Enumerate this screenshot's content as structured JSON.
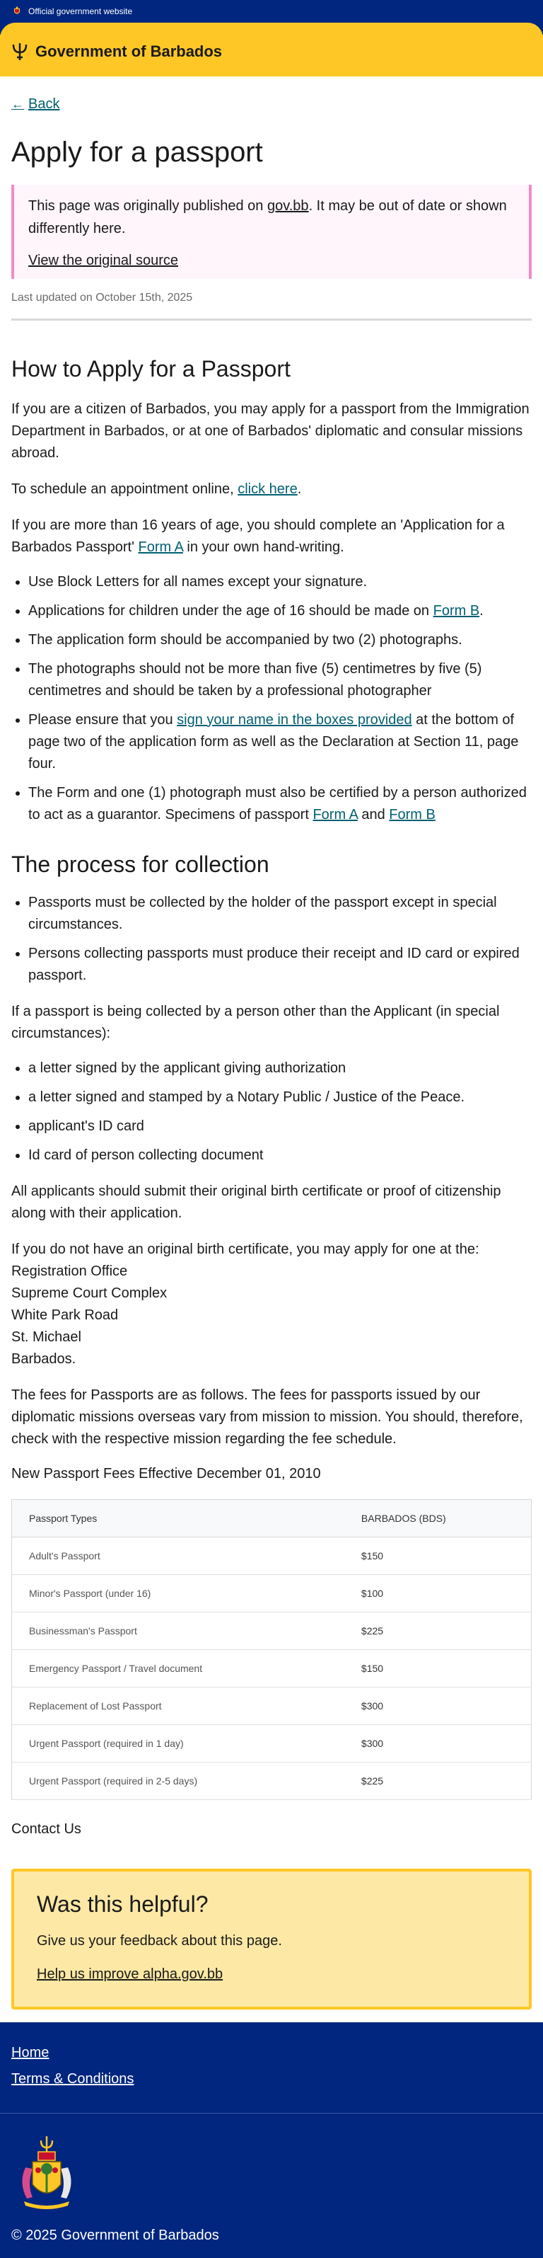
{
  "topbar": {
    "label": "Official government website"
  },
  "header": {
    "brand": "Government of Barbados"
  },
  "nav": {
    "back": "Back"
  },
  "page": {
    "title": "Apply for a passport",
    "notice_prefix": "This page was originally published on ",
    "notice_link": "gov.bb",
    "notice_suffix": ". It may be out of date or shown differently here.",
    "notice_source": "View the original source",
    "updated": "Last updated on October 15th, 2025"
  },
  "how": {
    "heading": "How to Apply for a Passport",
    "p1": "If you are a citizen of Barbados, you may apply for a passport from the Immigration Department in Barbados, or at one of Barbados' diplomatic and consular missions abroad.",
    "p2_prefix": "To schedule an appointment online, ",
    "p2_link": "click here",
    "p2_suffix": ".",
    "p3_prefix": "If you are more than 16 years of age, you should complete an 'Application for a Barbados Passport' ",
    "p3_link": "Form A",
    "p3_suffix": " in your own hand-writing.",
    "b1": "Use Block Letters for all names except your signature.",
    "b2_prefix": "Applications for children under the age of 16 should be made on ",
    "b2_link": "Form B",
    "b2_suffix": ".",
    "b3": "The application form should be accompanied by two (2) photographs.",
    "b4": "The photographs should not be more than five (5) centimetres by five (5) centimetres and should be taken by a professional photographer",
    "b5_prefix": "Please ensure that you ",
    "b5_link": "sign your name in the boxes provided",
    "b5_suffix": " at the bottom of page two of the application form as well as the Declaration at Section 11, page four.",
    "b6_prefix": "The Form and one (1) photograph must also be certified by a person authorized to act as a guarantor. Specimens of passport ",
    "b6_link1": "Form A",
    "b6_mid": " and ",
    "b6_link2": "Form B"
  },
  "collection": {
    "heading": "The process for collection",
    "b1": "Passports must be collected by the holder of the passport except in special circumstances.",
    "b2": "Persons collecting passports must produce their receipt and ID card or expired passport.",
    "p1": "If a passport is being collected by a person other than the Applicant (in special circumstances):",
    "c1": "a letter signed by the applicant giving authorization",
    "c2": "a letter signed and stamped by a Notary Public / Justice of the Peace.",
    "c3": "applicant's ID card",
    "c4": "Id card of person collecting document",
    "p2": "All applicants should submit their original birth certificate or proof of citizenship along with their application.",
    "p3": "If you do not have an original birth certificate, you may apply for one at the:",
    "addr1": "Registration Office",
    "addr2": "Supreme Court Complex",
    "addr3": "White Park Road",
    "addr4": "St. Michael",
    "addr5": "Barbados.",
    "p4": "The fees for Passports are as follows. The fees for passports issued by our diplomatic missions overseas vary from mission to mission. You should, therefore, check with the respective mission regarding the fee schedule.",
    "fees_title": "New Passport Fees Effective December 01, 2010"
  },
  "fees": {
    "col1": "Passport Types",
    "col2": "BARBADOS (BDS)",
    "rows": [
      {
        "type": "Adult's Passport",
        "price": "$150"
      },
      {
        "type": "Minor's Passport (under 16)",
        "price": "$100"
      },
      {
        "type": "Businessman's Passport",
        "price": "$225"
      },
      {
        "type": "Emergency Passport / Travel document",
        "price": "$150"
      },
      {
        "type": "Replacement of Lost Passport",
        "price": "$300"
      },
      {
        "type": "Urgent Passport (required in 1 day)",
        "price": "$300"
      },
      {
        "type": "Urgent Passport (required in 2-5 days)",
        "price": "$225"
      }
    ]
  },
  "contact": {
    "label": "Contact Us"
  },
  "feedback": {
    "heading": "Was this helpful?",
    "text": "Give us your feedback about this page.",
    "link": "Help us improve alpha.gov.bb"
  },
  "footer": {
    "home": "Home",
    "terms": "Terms & Conditions",
    "copyright": "© 2025 Government of Barbados"
  },
  "icons": {
    "trident": "trident-icon",
    "crest": "coat-of-arms-icon",
    "back": "arrow-left-icon"
  },
  "colors": {
    "navy": "#00267f",
    "gold": "#ffc726",
    "link": "#005f73",
    "notice_border": "#f08cc8"
  }
}
